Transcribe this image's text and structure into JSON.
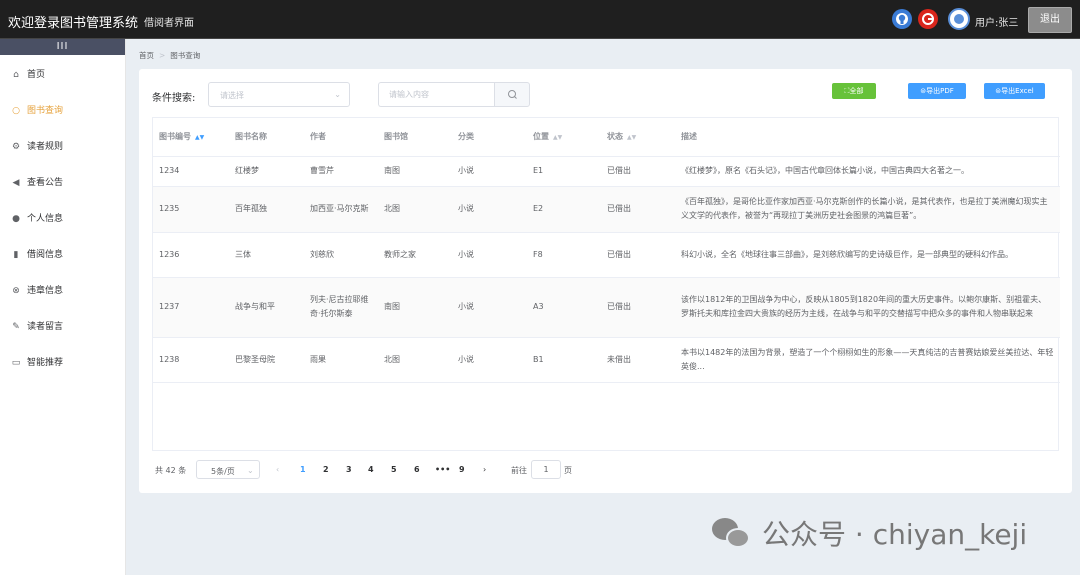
{
  "header": {
    "title": "欢迎登录图书管理系统",
    "subtitle": "借阅者界面",
    "user": "用户:张三",
    "logout": "退出",
    "icons": [
      "github-icon",
      "gitee-icon",
      "avatar"
    ]
  },
  "sidebar": {
    "collapse": "III",
    "items": [
      {
        "label": "首页",
        "icon": "home-icon"
      },
      {
        "label": "图书查询",
        "icon": "search-icon",
        "active": true
      },
      {
        "label": "读者规则",
        "icon": "gear-icon"
      },
      {
        "label": "查看公告",
        "icon": "speaker-icon"
      },
      {
        "label": "个人信息",
        "icon": "user-icon"
      },
      {
        "label": "借阅信息",
        "icon": "book-icon"
      },
      {
        "label": "违章信息",
        "icon": "warning-icon"
      },
      {
        "label": "读者留言",
        "icon": "edit-icon"
      },
      {
        "label": "智能推荐",
        "icon": "monitor-icon"
      }
    ]
  },
  "breadcrumb": {
    "home": "首页",
    "current": "图书查询"
  },
  "search": {
    "label": "条件搜索:",
    "select_placeholder": "请选择",
    "keyword_placeholder": "请输入内容"
  },
  "actions": {
    "all": "全部",
    "pdf": "导出PDF",
    "excel": "导出Excel"
  },
  "table": {
    "columns": [
      "图书编号",
      "图书名称",
      "作者",
      "图书馆",
      "分类",
      "位置",
      "状态",
      "描述"
    ],
    "rows": [
      [
        "1234",
        "红楼梦",
        "曹雪芹",
        "南图",
        "小说",
        "E1",
        "已借出",
        "《红楼梦》，原名《石头记》，中国古代章回体长篇小说，中国古典四大名著之一。"
      ],
      [
        "1235",
        "百年孤独",
        "加西亚·马尔克斯",
        "北图",
        "小说",
        "E2",
        "已借出",
        "《百年孤独》，是哥伦比亚作家加西亚·马尔克斯创作的长篇小说，是其代表作，也是拉丁美洲魔幻现实主义文学的代表作，被誉为“再现拉丁美洲历史社会图景的鸿篇巨著”。"
      ],
      [
        "1236",
        "三体",
        "刘慈欣",
        "教师之家",
        "小说",
        "F8",
        "已借出",
        "科幻小说，全名《地球往事三部曲》，是刘慈欣编写的史诗级巨作，是一部典型的硬科幻作品。"
      ],
      [
        "1237",
        "战争与和平",
        "列夫·尼古拉耶维奇·托尔斯泰",
        "南图",
        "小说",
        "A3",
        "已借出",
        "该作以1812年的卫国战争为中心，反映从1805到1820年间的重大历史事件。以鲍尔康斯、别祖霍夫、罗斯托夫和库拉金四大贵族的经历为主线，在战争与和平的交替描写中把众多的事件和人物串联起来"
      ],
      [
        "1238",
        "巴黎圣母院",
        "雨果",
        "北图",
        "小说",
        "B1",
        "未借出",
        "本书以1482年的法国为背景，塑造了一个个栩栩如生的形象——天真纯洁的吉普赛姑娘爱丝美拉达、年轻英俊..."
      ]
    ]
  },
  "pagination": {
    "total": "共 42 条",
    "page_size": "5条/页",
    "pages": [
      "1",
      "2",
      "3",
      "4",
      "5",
      "6",
      "•••",
      "9"
    ],
    "current": "1",
    "goto_prefix": "前往",
    "goto_value": "1",
    "goto_suffix": "页"
  },
  "watermark": "公众号 · chiyan_keji",
  "colors": {
    "accent": "#409eff",
    "active_menu": "#e6a23c",
    "green": "#67c23a",
    "header": "#1f1f1f"
  }
}
